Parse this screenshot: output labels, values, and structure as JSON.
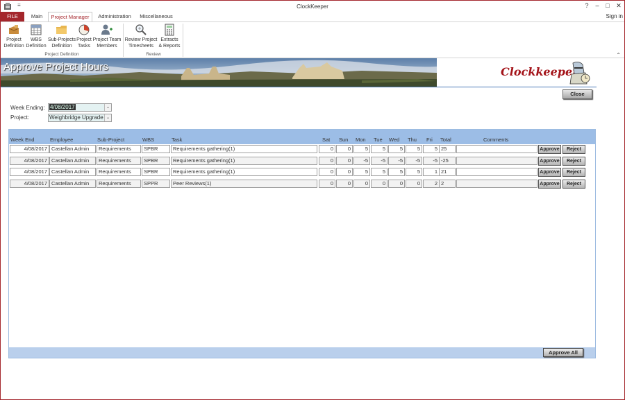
{
  "window": {
    "title": "ClockKeeper",
    "signin": "Sign in",
    "controls": {
      "help": "?",
      "minimize": "–",
      "maximize": "□",
      "close": "✕"
    }
  },
  "tabs": [
    {
      "label": "FILE"
    },
    {
      "label": "Main"
    },
    {
      "label": "Project Manager"
    },
    {
      "label": "Administration"
    },
    {
      "label": "Miscellaneous"
    }
  ],
  "ribbon": {
    "buttons": [
      {
        "label": "Project\nDefinition",
        "icon": "project-definition-icon"
      },
      {
        "label": "WBS\nDefinition",
        "icon": "wbs-definition-icon"
      },
      {
        "label": "Sub-Projects\nDefinition",
        "icon": "folder-icon"
      },
      {
        "label": "Project\nTasks",
        "icon": "pie-chart-icon"
      },
      {
        "label": "Project Team\nMembers",
        "icon": "team-members-icon"
      },
      {
        "label": "Review Project\nTimesheets",
        "icon": "magnifier-icon"
      },
      {
        "label": "Extracts\n& Reports",
        "icon": "calculator-icon"
      }
    ],
    "groups": [
      {
        "label": "Project Definition"
      },
      {
        "label": "Review"
      }
    ]
  },
  "page": {
    "title": "Approve Project Hours",
    "logo": "Clockkeeper",
    "close_label": "Close"
  },
  "filters": {
    "week_ending_label": "Week Ending:",
    "week_ending_value": "4/08/2017",
    "project_label": "Project:",
    "project_value": "Weighbridge Upgrade"
  },
  "grid": {
    "columns": [
      "Week End",
      "Employee",
      "Sub-Project",
      "WBS",
      "Task",
      "Sat",
      "Sun",
      "Mon",
      "Tue",
      "Wed",
      "Thu",
      "Fri",
      "Total",
      "Comments"
    ],
    "rows": [
      {
        "week_end": "4/08/2017",
        "employee": "Castellan Admin",
        "sub_project": "Requirements",
        "wbs": "SPBR",
        "task": "Requirements gathering(1)",
        "sat": "0",
        "sun": "0",
        "mon": "5",
        "tue": "5",
        "wed": "5",
        "thu": "5",
        "fri": "5",
        "total": "25",
        "comments": ""
      },
      {
        "week_end": "4/08/2017",
        "employee": "Castellan Admin",
        "sub_project": "Requirements",
        "wbs": "SPBR",
        "task": "Requirements gathering(1)",
        "sat": "0",
        "sun": "0",
        "mon": "-5",
        "tue": "-5",
        "wed": "-5",
        "thu": "-5",
        "fri": "-5",
        "total": "-25",
        "comments": ""
      },
      {
        "week_end": "4/08/2017",
        "employee": "Castellan Admin",
        "sub_project": "Requirements",
        "wbs": "SPBR",
        "task": "Requirements gathering(1)",
        "sat": "0",
        "sun": "0",
        "mon": "5",
        "tue": "5",
        "wed": "5",
        "thu": "5",
        "fri": "1",
        "total": "21",
        "comments": ""
      },
      {
        "week_end": "4/08/2017",
        "employee": "Castellan Admin",
        "sub_project": "Requirements",
        "wbs": "SPPR",
        "task": "Peer Reviews(1)",
        "sat": "0",
        "sun": "0",
        "mon": "0",
        "tue": "0",
        "wed": "0",
        "thu": "0",
        "fri": "2",
        "total": "2",
        "comments": ""
      }
    ],
    "approve_label": "Approve",
    "reject_label": "Reject",
    "approve_all_label": "Approve All"
  },
  "colors": {
    "accent": "#a4262c",
    "grid_header": "#9cbde6",
    "grid_footer": "#b9cfec",
    "combo_bg": "#e4f2f2"
  }
}
